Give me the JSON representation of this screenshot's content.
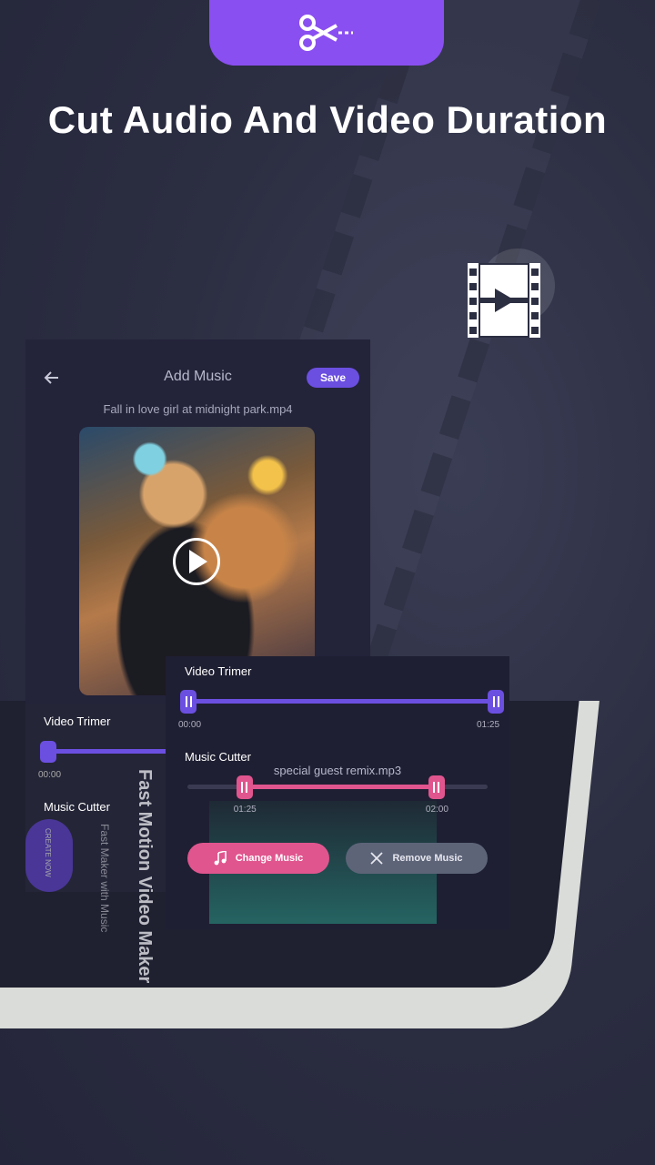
{
  "headline": "Cut Audio And Video Duration",
  "icons": {
    "top_badge": "scissors-icon",
    "film": "film-play-icon",
    "back": "arrow-left-icon",
    "play": "play-icon",
    "music": "music-note-icon",
    "remove": "close-icon"
  },
  "colors": {
    "accent_purple": "#8a4ff0",
    "trimmer_purple": "#6b4fe0",
    "cutter_pink": "#e0558e",
    "background": "#2c2e42"
  },
  "editor": {
    "title": "Add Music",
    "save_label": "Save",
    "filename": "Fall in love girl at midnight park.mp4"
  },
  "video_trimmer": {
    "label": "Video Trimer",
    "start_time": "00:00",
    "end_time": "01:25",
    "start_fraction": 0,
    "end_fraction": 1
  },
  "music_cutter": {
    "label": "Music Cutter",
    "track_name": "special guest remix.mp3",
    "start_time": "01:25",
    "end_time": "02:00",
    "start_fraction": 0.19,
    "end_fraction": 0.83
  },
  "buttons": {
    "change_music": "Change Music",
    "remove_music": "Remove Music"
  },
  "background_device": {
    "video_trimmer_label": "Video Trimer",
    "start_time": "00:00",
    "music_cutter_label": "Music Cutter",
    "app_name": "Fast Motion Video Maker",
    "app_tagline": "Fast Maker with Music",
    "side_text": "CREATE NOW"
  }
}
